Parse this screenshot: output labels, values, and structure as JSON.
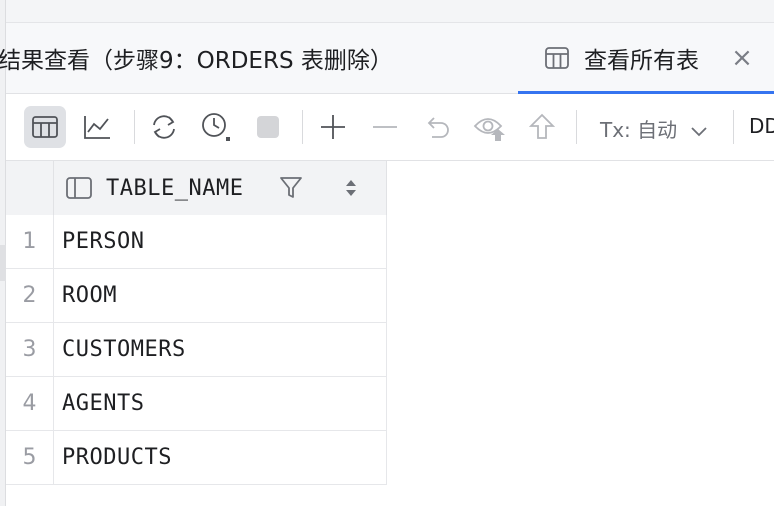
{
  "tabs": [
    {
      "label": "结果查看（步骤9：ORDERS 表删除）",
      "active": false
    },
    {
      "label": "查看所有表",
      "active": true
    }
  ],
  "toolbar": {
    "tx_label": "Tx: 自动",
    "ddl_label": "DD"
  },
  "grid": {
    "columns": [
      {
        "name": "TABLE_NAME"
      }
    ],
    "rows": [
      {
        "num": "1",
        "value": "PERSON"
      },
      {
        "num": "2",
        "value": "ROOM"
      },
      {
        "num": "3",
        "value": "CUSTOMERS"
      },
      {
        "num": "4",
        "value": "AGENTS"
      },
      {
        "num": "5",
        "value": "PRODUCTS"
      }
    ]
  },
  "colors": {
    "accent": "#3574f0",
    "tab_bar_bg": "#f7f8fa",
    "header_bg": "#f2f3f5"
  }
}
